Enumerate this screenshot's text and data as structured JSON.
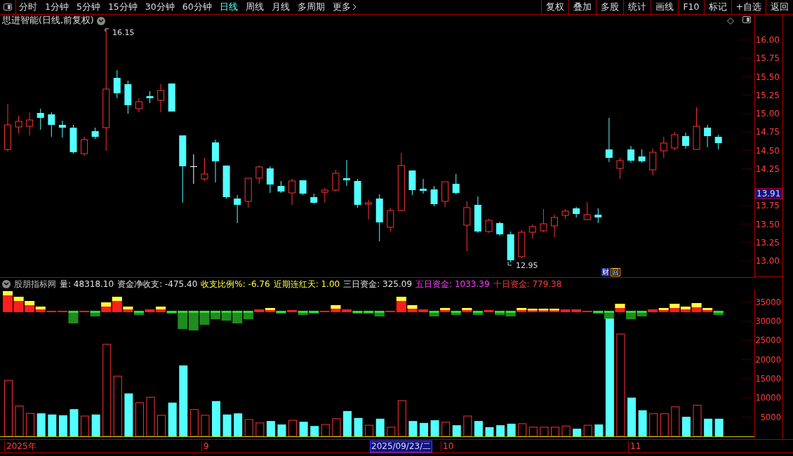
{
  "toolbar": {
    "periods": [
      {
        "label": "分时",
        "selected": false
      },
      {
        "label": "1分钟",
        "selected": false
      },
      {
        "label": "5分钟",
        "selected": false
      },
      {
        "label": "15分钟",
        "selected": false
      },
      {
        "label": "30分钟",
        "selected": false
      },
      {
        "label": "60分钟",
        "selected": false
      },
      {
        "label": "日线",
        "selected": true
      },
      {
        "label": "周线",
        "selected": false
      },
      {
        "label": "月线",
        "selected": false
      },
      {
        "label": "多周期",
        "selected": false
      }
    ],
    "more": "更多",
    "buttons": [
      "复权",
      "叠加",
      "多股",
      "统计",
      "画线",
      "F10",
      "标记",
      "+自选",
      "返回"
    ]
  },
  "main_chart": {
    "title": "思进智能(日线,前复权)",
    "high_label": "16.15",
    "low_label": "12.95",
    "badges": [
      "财",
      "回"
    ],
    "price_axis": [
      "16.00",
      "15.75",
      "15.50",
      "15.25",
      "15.00",
      "14.75",
      "14.50",
      "14.25",
      "13.75",
      "13.50",
      "13.25",
      "13.00"
    ],
    "current_price": "13.91"
  },
  "indicator": {
    "name": "股朋指标网",
    "readings": [
      {
        "text": "量: 48318.10",
        "color": "#e0e0e0"
      },
      {
        "text": "资金净收支: -475.40",
        "color": "#e0e0e0"
      },
      {
        "text": "收支比例%: -6.76",
        "color": "#ffff3c"
      },
      {
        "text": "近期连红天: 1.00",
        "color": "#ffff3c"
      },
      {
        "text": "三日资金: 325.09",
        "color": "#e0e0e0"
      },
      {
        "text": "五日资金: 1033.39",
        "color": "#ff3cff"
      },
      {
        "text": "十日资金: 779.38",
        "color": "#ff3c3c"
      }
    ],
    "volume_axis": [
      "35000",
      "30000",
      "25000",
      "20000",
      "15000",
      "10000",
      "5000"
    ]
  },
  "date_axis": [
    {
      "text": "2025年",
      "kind": "tick"
    },
    {
      "text": "9",
      "kind": "tick"
    },
    {
      "text": "2025/09/23/二",
      "kind": "cursor"
    },
    {
      "text": "10",
      "kind": "tick"
    },
    {
      "text": "11",
      "kind": "tick"
    }
  ]
}
